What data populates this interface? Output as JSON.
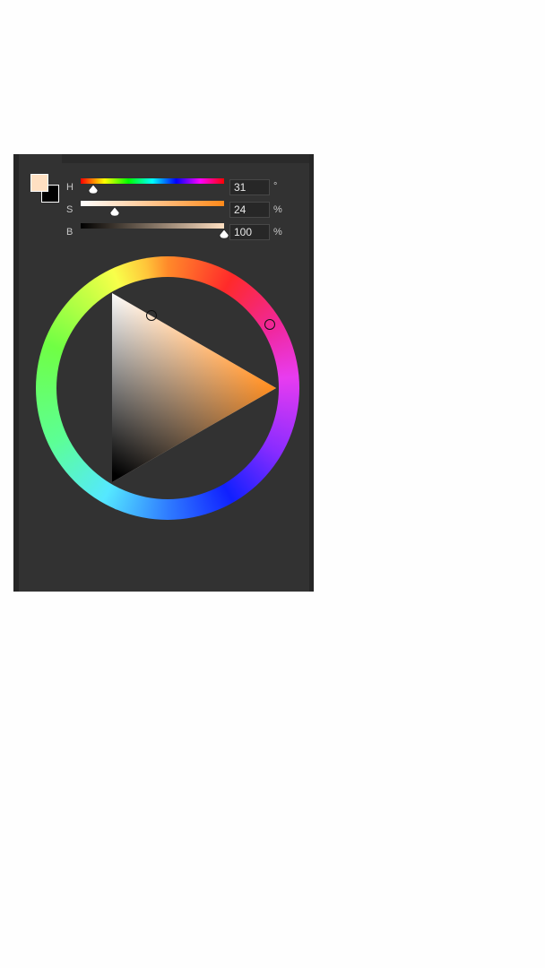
{
  "picker": {
    "foreground_color": "#ffe0c2",
    "background_color": "#000000",
    "hue": {
      "label": "H",
      "value": "31",
      "unit": "°",
      "level": 0.086
    },
    "saturation": {
      "label": "S",
      "value": "24",
      "unit": "%",
      "level": 0.24
    },
    "brightness": {
      "label": "B",
      "value": "100",
      "unit": "%",
      "level": 1.0
    },
    "pure_hue_color": "#ff8a1a"
  }
}
